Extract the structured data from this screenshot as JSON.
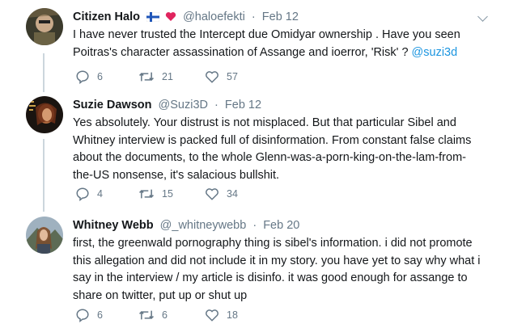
{
  "tweets": [
    {
      "name": "Citizen Halo",
      "handle": "@haloefekti",
      "separator": "·",
      "date": "Feb 12",
      "text_parts": [
        "I have never trusted the Intercept due Omidyar ownership . Have you seen",
        "Poitras's character assassination of Assange and ioerror, 'Risk' ? "
      ],
      "mention": "@suzi3d",
      "replies": "6",
      "retweets": "21",
      "likes": "57"
    },
    {
      "name": "Suzie Dawson",
      "handle": "@Suzi3D",
      "separator": "·",
      "date": "Feb 12",
      "lines": [
        "Yes absolutely. Your distrust is not misplaced. But that particular Sibel and",
        "Whitney interview is packed full of disinformation. From constant false claims",
        "about the documents, to the whole Glenn-was-a-porn-king-on-the-lam-from-",
        "the-US nonsense, it's salacious bullshit."
      ],
      "replies": "4",
      "retweets": "15",
      "likes": "34"
    },
    {
      "name": "Whitney Webb",
      "handle": "@_whitneywebb",
      "separator": "·",
      "date": "Feb 20",
      "lines": [
        "first, the greenwald pornography thing is sibel's information. i did not promote",
        "this allegation and did not include it in my story. you have yet to say why what i",
        "say in the interview / my article is disinfo. it was good enough for assange to",
        "share on twitter, put up or shut up"
      ],
      "replies": "6",
      "retweets": "6",
      "likes": "18"
    }
  ],
  "icons": {
    "reply": "reply-icon",
    "retweet": "retweet-icon",
    "like": "heart-icon",
    "more": "chevron-down-icon",
    "flags": [
      "finland-flag-icon",
      "heart-emoji-icon"
    ]
  },
  "colors": {
    "accent": "#1b95e0",
    "secondary_text": "#657786",
    "thread_line": "#ccd6dd"
  }
}
